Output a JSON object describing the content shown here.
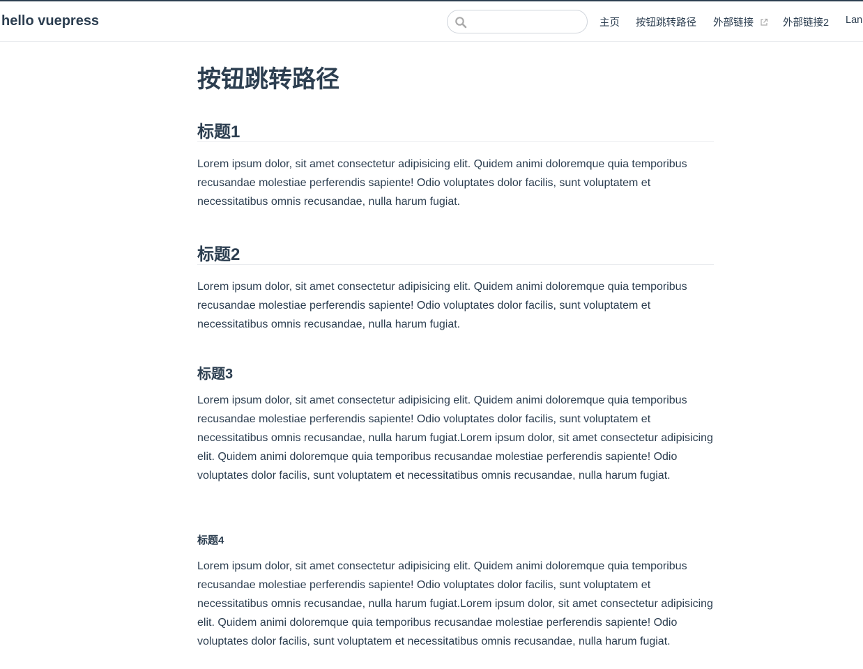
{
  "navbar": {
    "site_name": "hello vuepress",
    "search": {
      "placeholder": "",
      "value": ""
    },
    "links": [
      {
        "label": "主页",
        "external": false
      },
      {
        "label": "按钮跳转路径",
        "external": false
      },
      {
        "label": "外部链接",
        "external": true
      },
      {
        "label": "外部链接2",
        "external": false
      },
      {
        "label": "Lan",
        "external": false
      }
    ]
  },
  "page": {
    "title": "按钮跳转路径",
    "sections": [
      {
        "heading": "标题1",
        "text": "Lorem ipsum dolor, sit amet consectetur adipisicing elit. Quidem animi doloremque quia temporibus recusandae molestiae perferendis sapiente! Odio voluptates dolor facilis, sunt voluptatem et necessitatibus omnis recusandae, nulla harum fugiat."
      },
      {
        "heading": "标题2",
        "text": "Lorem ipsum dolor, sit amet consectetur adipisicing elit. Quidem animi doloremque quia temporibus recusandae molestiae perferendis sapiente! Odio voluptates dolor facilis, sunt voluptatem et necessitatibus omnis recusandae, nulla harum fugiat."
      },
      {
        "heading": "标题3",
        "text": "Lorem ipsum dolor, sit amet consectetur adipisicing elit. Quidem animi doloremque quia temporibus recusandae molestiae perferendis sapiente! Odio voluptates dolor facilis, sunt voluptatem et necessitatibus omnis recusandae, nulla harum fugiat.Lorem ipsum dolor, sit amet consectetur adipisicing elit. Quidem animi doloremque quia temporibus recusandae molestiae perferendis sapiente! Odio voluptates dolor facilis, sunt voluptatem et necessitatibus omnis recusandae, nulla harum fugiat."
      },
      {
        "heading": "标题4",
        "text": "Lorem ipsum dolor, sit amet consectetur adipisicing elit. Quidem animi doloremque quia temporibus recusandae molestiae perferendis sapiente! Odio voluptates dolor facilis, sunt voluptatem et necessitatibus omnis recusandae, nulla harum fugiat.Lorem ipsum dolor, sit amet consectetur adipisicing elit. Quidem animi doloremque quia temporibus recusandae molestiae perferendis sapiente! Odio voluptates dolor facilis, sunt voluptatem et necessitatibus omnis recusandae, nulla harum fugiat."
      }
    ]
  },
  "icons": {
    "search": "search-icon",
    "external_link": "external-link-icon"
  },
  "colors": {
    "text": "#2c3e50",
    "border": "#eaecef",
    "search_border": "#cfd4db",
    "muted_icon": "#aaaaaa"
  }
}
